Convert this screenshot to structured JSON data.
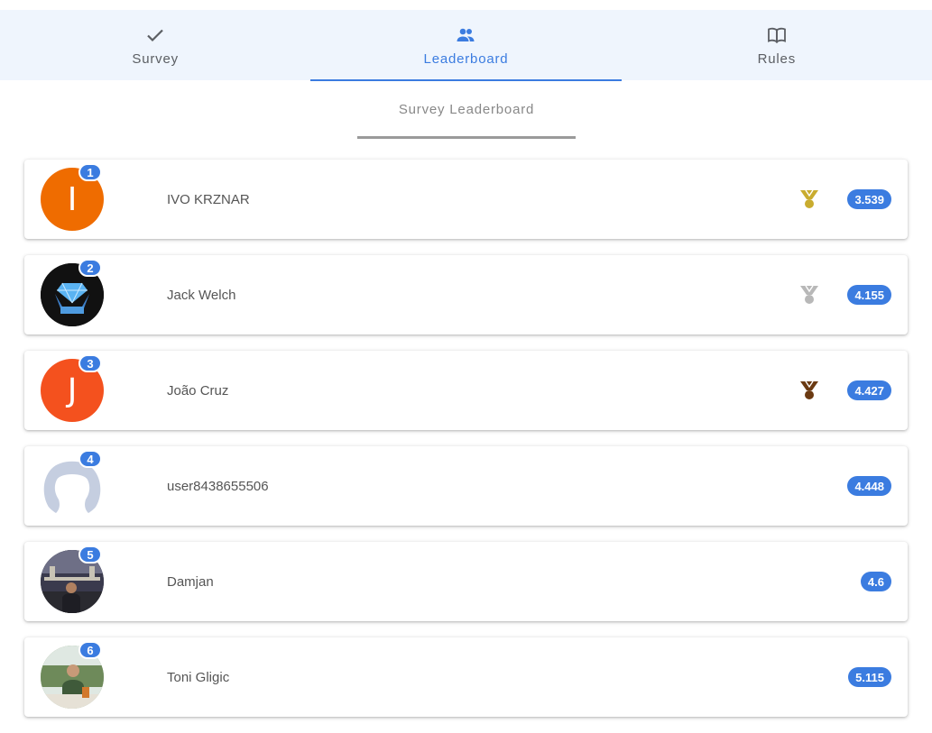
{
  "tabs": [
    {
      "label": "Survey",
      "icon": "check-icon",
      "active": false
    },
    {
      "label": "Leaderboard",
      "icon": "people-icon",
      "active": true
    },
    {
      "label": "Rules",
      "icon": "book-icon",
      "active": false
    }
  ],
  "subheader": {
    "title": "Survey Leaderboard"
  },
  "colors": {
    "accent": "#3b7ce0",
    "tabbar_bg": "#eff5fd",
    "gold": "#c9ac2f",
    "silver": "#b8b8b8",
    "bronze": "#6b3a12"
  },
  "leaderboard": [
    {
      "rank": "1",
      "name": "IVO KRZNAR",
      "score": "3.539",
      "avatar_initial": "I",
      "avatar_color": "#ef6c00",
      "medal": "gold-medal-icon"
    },
    {
      "rank": "2",
      "name": "Jack Welch",
      "score": "4.155",
      "avatar_initial": "",
      "avatar_color": "#111111",
      "medal": "silver-medal-icon"
    },
    {
      "rank": "3",
      "name": "João Cruz",
      "score": "4.427",
      "avatar_initial": "J",
      "avatar_color": "#f4511e",
      "medal": "bronze-medal-icon"
    },
    {
      "rank": "4",
      "name": "user8438655506",
      "score": "4.448",
      "avatar_initial": "",
      "avatar_color": "#c5cee0",
      "medal": ""
    },
    {
      "rank": "5",
      "name": "Damjan",
      "score": "4.6",
      "avatar_initial": "",
      "avatar_color": "#2b2b3a",
      "medal": ""
    },
    {
      "rank": "6",
      "name": "Toni Gligic",
      "score": "5.115",
      "avatar_initial": "",
      "avatar_color": "#6e8a5a",
      "medal": ""
    }
  ]
}
